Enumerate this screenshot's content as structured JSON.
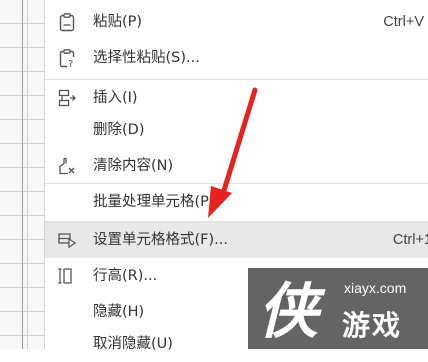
{
  "context_menu": {
    "items": [
      {
        "icon": "paste-icon",
        "label": "粘贴(P)",
        "shortcut": "Ctrl+V"
      },
      {
        "icon": "paste-special-icon",
        "label": "选择性粘贴(S)..."
      },
      {
        "icon": "insert-icon",
        "label": "插入(I)"
      },
      {
        "icon": "",
        "label": "删除(D)"
      },
      {
        "icon": "clear-contents-icon",
        "label": "清除内容(N)"
      },
      {
        "icon": "",
        "label": "批量处理单元格(P)"
      },
      {
        "icon": "format-cells-icon",
        "label": "设置单元格格式(F)...",
        "shortcut": "Ctrl+1",
        "highlighted": true
      },
      {
        "icon": "row-height-icon",
        "label": "行高(R)..."
      },
      {
        "icon": "",
        "label": "隐藏(H)"
      },
      {
        "icon": "",
        "label": "取消隐藏(U)"
      }
    ]
  },
  "annotation": {
    "type": "arrow",
    "color": "#e8231f",
    "points_to": "设置单元格格式(F)..."
  },
  "watermark": {
    "site": "xiayx.com",
    "name": "游戏",
    "mark_glyph": "侠"
  }
}
